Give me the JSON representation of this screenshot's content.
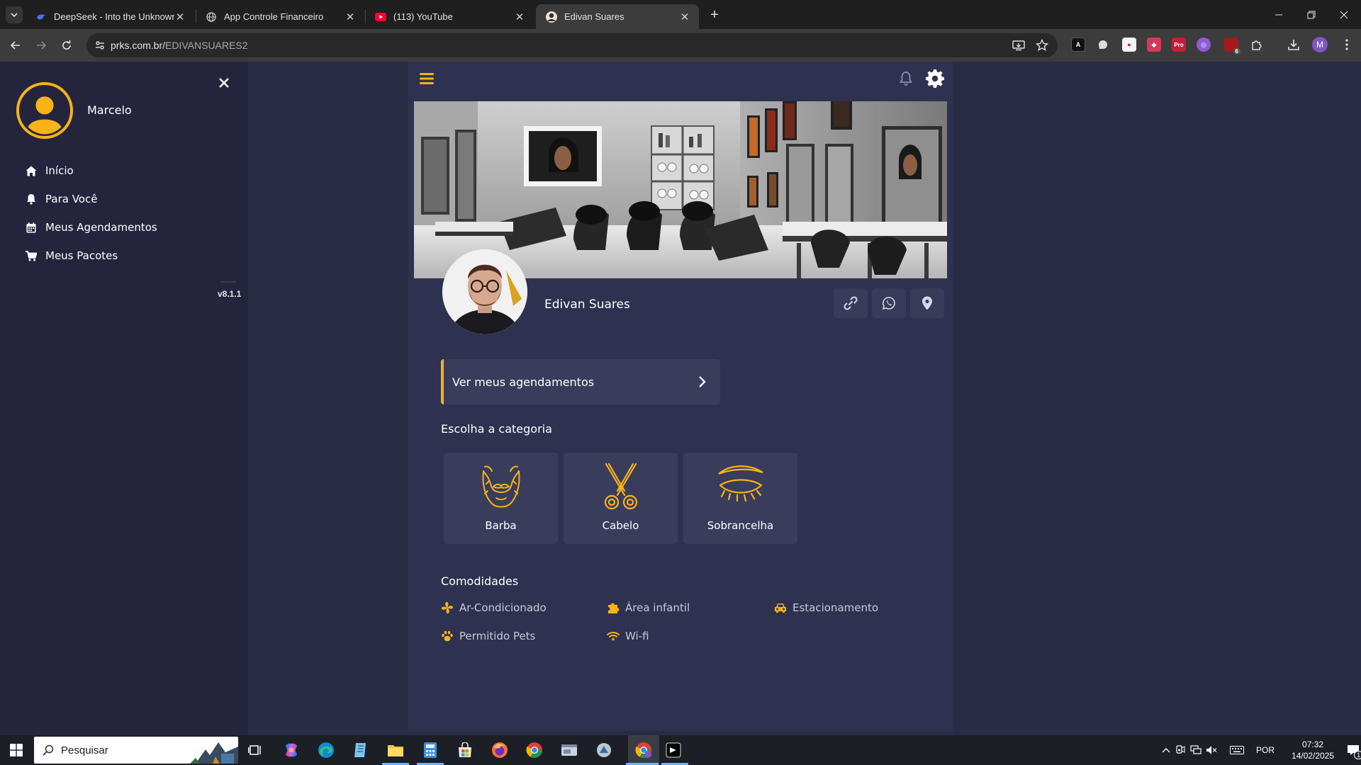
{
  "browser": {
    "tabs": [
      {
        "title": "DeepSeek - Into the Unknown",
        "favicon": "deepseek-icon"
      },
      {
        "title": "App Controle Financeiro",
        "favicon": "globe-icon"
      },
      {
        "title": "(113) YouTube",
        "favicon": "youtube-icon"
      },
      {
        "title": "Edivan Suares",
        "favicon": "profile-favicon",
        "active": true
      }
    ],
    "url_host": "prks.com.br/",
    "url_path": "EDIVANSUARES2",
    "profile_initial": "M",
    "ext_badge": "6"
  },
  "sidebar": {
    "user_name": "Marcelo",
    "menu": [
      {
        "label": "Início",
        "icon": "home-icon"
      },
      {
        "label": "Para Você",
        "icon": "bell-icon"
      },
      {
        "label": "Meus Agendamentos",
        "icon": "calendar-icon"
      },
      {
        "label": "Meus Pacotes",
        "icon": "cart-icon"
      }
    ],
    "version": "v8.1.1"
  },
  "profile": {
    "name": "Edivan Suares",
    "appointments_label": "Ver meus agendamentos",
    "category_title": "Escolha a categoria",
    "categories": [
      {
        "label": "Barba",
        "icon": "beard-icon"
      },
      {
        "label": "Cabelo",
        "icon": "scissors-icon"
      },
      {
        "label": "Sobrancelha",
        "icon": "eyebrow-icon"
      }
    ],
    "amenities_title": "Comodidades",
    "amenities": [
      {
        "label": "Ar-Condicionado",
        "icon": "fan-icon"
      },
      {
        "label": "Área infantil",
        "icon": "puzzle-icon"
      },
      {
        "label": "Estacionamento",
        "icon": "car-icon"
      },
      {
        "label": "Permitido Pets",
        "icon": "paw-icon"
      },
      {
        "label": "Wi-fi",
        "icon": "wifi-icon"
      }
    ]
  },
  "taskbar": {
    "search_placeholder": "Pesquisar",
    "language": "POR",
    "time": "07:32",
    "date": "14/02/2025",
    "notifications": "1"
  },
  "colors": {
    "accent": "#f8b318",
    "sidebar_bg": "#24253d",
    "page_bg": "#2a2c45",
    "card_bg": "#3a3c5c"
  }
}
